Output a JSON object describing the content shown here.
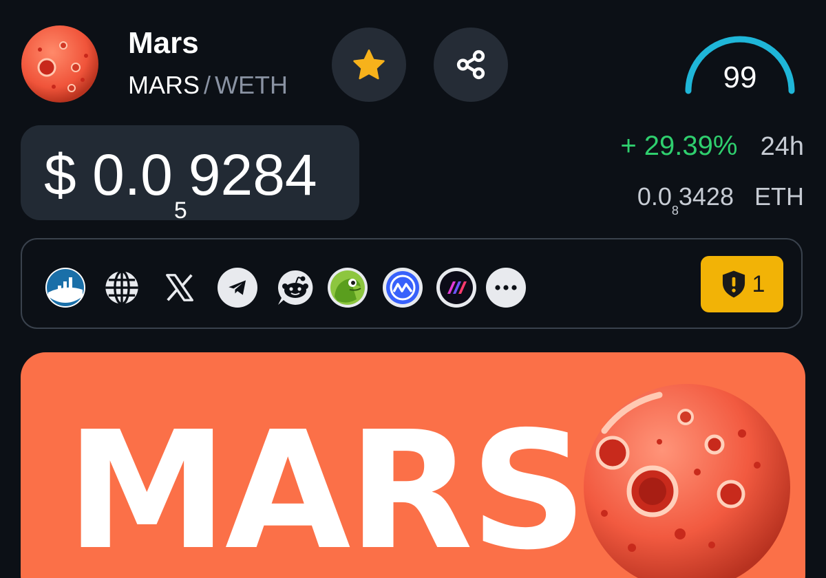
{
  "token": {
    "name": "Mars",
    "base_symbol": "MARS",
    "separator": "/",
    "quote_symbol": "WETH",
    "logo_icon": "mars-planet-logo"
  },
  "actions": {
    "favorite_icon": "star-icon",
    "share_icon": "share-icon"
  },
  "score": {
    "value": "99"
  },
  "price": {
    "currency": "$",
    "prefix": "0.0",
    "zero_count": "5",
    "digits": "9284"
  },
  "change": {
    "percent": "+ 29.39%",
    "period": "24h"
  },
  "eth_price": {
    "prefix": "0.0",
    "zero_count": "8",
    "digits": "3428",
    "unit": "ETH"
  },
  "links": [
    {
      "name": "coingecko-chart-icon"
    },
    {
      "name": "website-globe-icon"
    },
    {
      "name": "x-twitter-icon"
    },
    {
      "name": "telegram-icon"
    },
    {
      "name": "reddit-icon"
    },
    {
      "name": "coingecko-icon"
    },
    {
      "name": "coinmarketcap-icon"
    },
    {
      "name": "dextools-icon"
    },
    {
      "name": "more-icon"
    }
  ],
  "warnings": {
    "count": "1",
    "icon": "shield-warning-icon"
  },
  "banner": {
    "text": "MARS"
  },
  "colors": {
    "background": "#0c1016",
    "positive": "#2fcf6e",
    "gauge": "#1fb6d8",
    "warning": "#f2b306",
    "banner": "#fb7048"
  }
}
